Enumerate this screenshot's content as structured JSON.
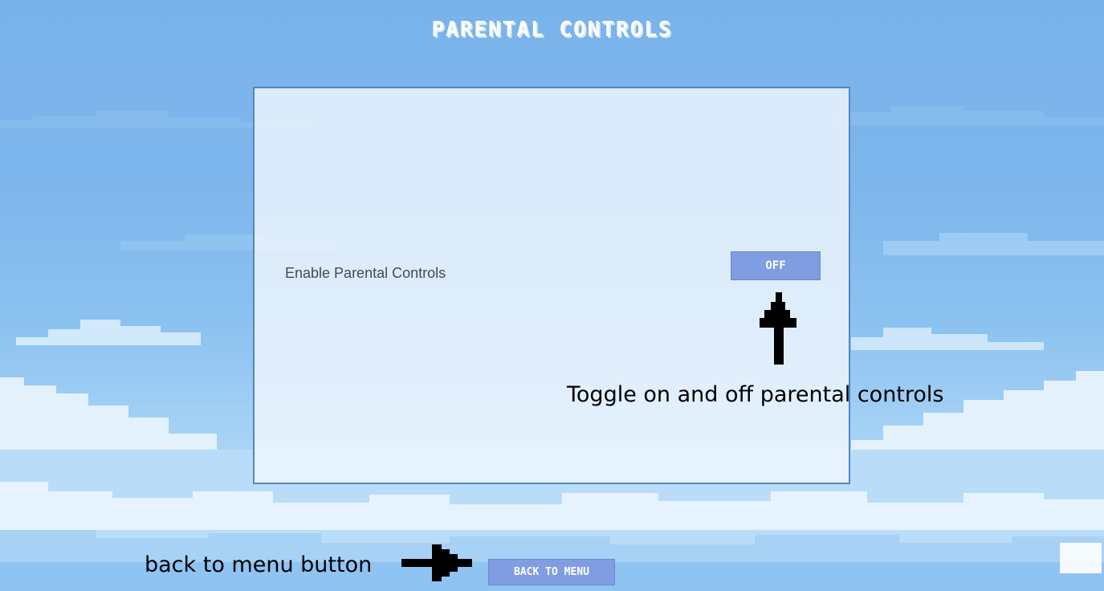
{
  "screen": {
    "title": "PARENTAL CONTROLS"
  },
  "settings": {
    "parental_controls": {
      "label": "Enable Parental Controls",
      "toggle_value": "OFF"
    }
  },
  "navigation": {
    "back_label": "BACK TO MENU"
  },
  "annotations": {
    "toggle_note": "Toggle on and off parental controls",
    "back_note": "back to menu button"
  },
  "icons": {
    "up_arrow": "arrow-up-icon",
    "right_arrow": "arrow-right-icon"
  },
  "colors": {
    "sky": "#7ab3ea",
    "button": "#7f9de0",
    "panel_border": "#4f86c6"
  }
}
